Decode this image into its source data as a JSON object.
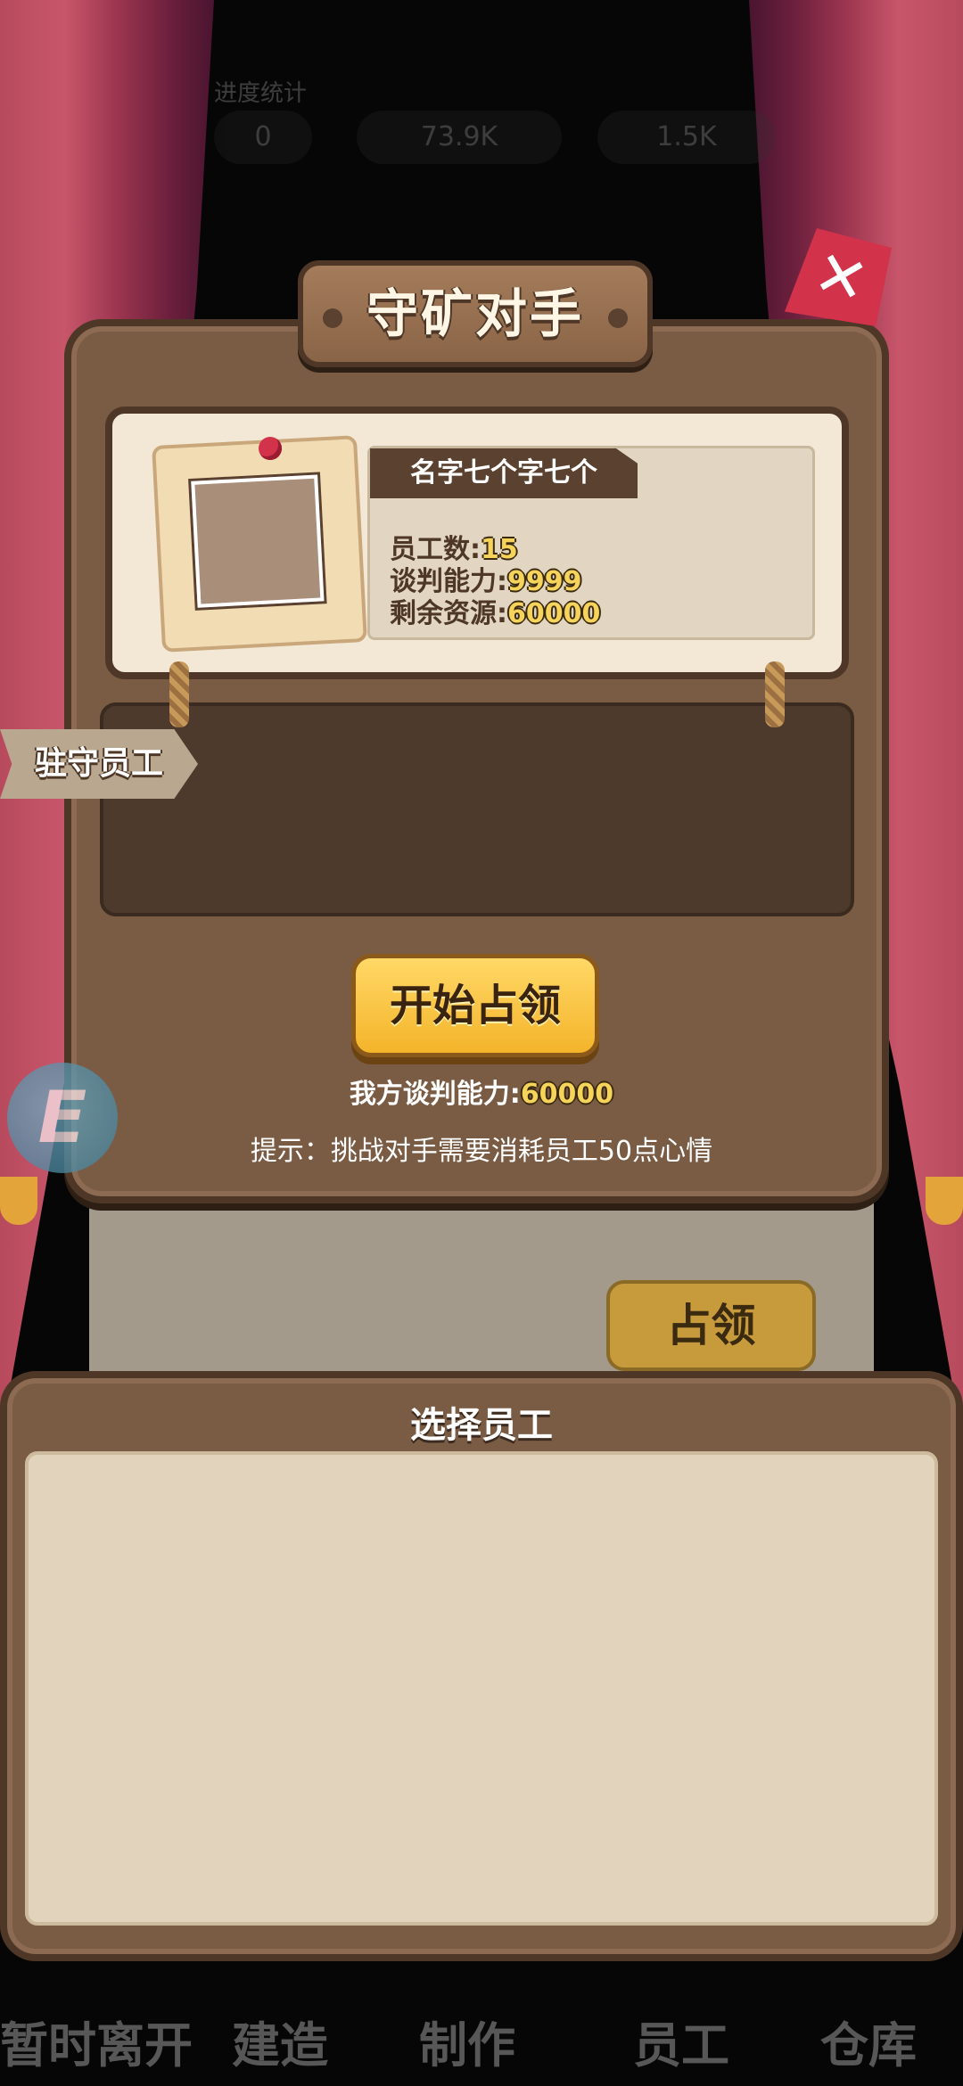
{
  "popup": {
    "title": "守矿对手",
    "opponent_name": "名字七个字七个",
    "stats": [
      {
        "label": "员工数:",
        "value": "15"
      },
      {
        "label": "谈判能力:",
        "value": "9999"
      },
      {
        "label": "剩余资源:",
        "value": "60000"
      }
    ],
    "staff_section_label": "驻守员工",
    "start_button": "开始占领",
    "our_power_label": "我方谈判能力:",
    "our_power_value": "60000",
    "hint": "提示：挑战对手需要消耗员工50点心情",
    "close_icon": "✕"
  },
  "background": {
    "claim_button": "占领",
    "hud_label": "进度统计",
    "hud_values": [
      "0",
      "73.9K",
      "1.5K"
    ],
    "badge_letter": "E"
  },
  "select_panel": {
    "title": "选择员工"
  },
  "bottom_nav": {
    "items": [
      "暂时离开",
      "建造",
      "制作",
      "员工",
      "仓库"
    ]
  }
}
